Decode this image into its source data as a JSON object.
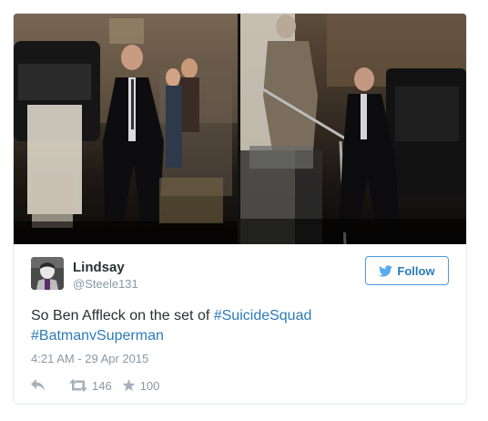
{
  "tweet": {
    "user": {
      "display_name": "Lindsay",
      "handle": "@Steele131"
    },
    "follow_label": "Follow",
    "text_prefix": "So Ben Affleck on the set of ",
    "hashtags": [
      "#SuicideSquad",
      "#BatmanvSuperman"
    ],
    "timestamp": "4:21 AM - 29 Apr 2015",
    "stats": {
      "retweets": "146",
      "likes": "100"
    },
    "media": {
      "photo_count": 2
    }
  },
  "colors": {
    "link": "#2b7bb9",
    "follow_border": "#4c9ad7",
    "text": "#292f33",
    "muted": "#8899a6",
    "card_border": "#e1e8ed"
  },
  "icons": {
    "follow": "bird-icon",
    "reply": "reply-arrow-icon",
    "retweet": "retweet-icon",
    "like": "star-icon"
  }
}
